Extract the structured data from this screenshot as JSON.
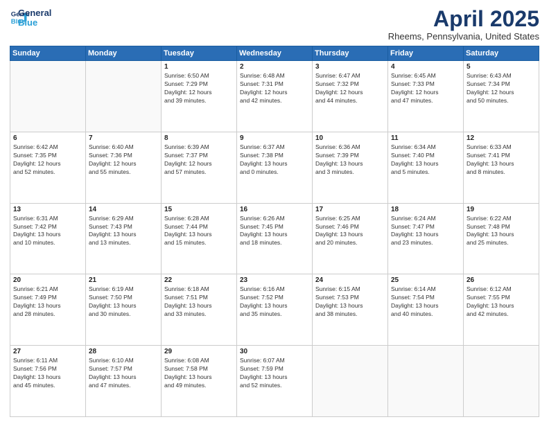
{
  "logo": {
    "line1": "General",
    "line2": "Blue"
  },
  "title": "April 2025",
  "location": "Rheems, Pennsylvania, United States",
  "days_of_week": [
    "Sunday",
    "Monday",
    "Tuesday",
    "Wednesday",
    "Thursday",
    "Friday",
    "Saturday"
  ],
  "weeks": [
    [
      {
        "day": "",
        "info": ""
      },
      {
        "day": "",
        "info": ""
      },
      {
        "day": "1",
        "info": "Sunrise: 6:50 AM\nSunset: 7:29 PM\nDaylight: 12 hours\nand 39 minutes."
      },
      {
        "day": "2",
        "info": "Sunrise: 6:48 AM\nSunset: 7:31 PM\nDaylight: 12 hours\nand 42 minutes."
      },
      {
        "day": "3",
        "info": "Sunrise: 6:47 AM\nSunset: 7:32 PM\nDaylight: 12 hours\nand 44 minutes."
      },
      {
        "day": "4",
        "info": "Sunrise: 6:45 AM\nSunset: 7:33 PM\nDaylight: 12 hours\nand 47 minutes."
      },
      {
        "day": "5",
        "info": "Sunrise: 6:43 AM\nSunset: 7:34 PM\nDaylight: 12 hours\nand 50 minutes."
      }
    ],
    [
      {
        "day": "6",
        "info": "Sunrise: 6:42 AM\nSunset: 7:35 PM\nDaylight: 12 hours\nand 52 minutes."
      },
      {
        "day": "7",
        "info": "Sunrise: 6:40 AM\nSunset: 7:36 PM\nDaylight: 12 hours\nand 55 minutes."
      },
      {
        "day": "8",
        "info": "Sunrise: 6:39 AM\nSunset: 7:37 PM\nDaylight: 12 hours\nand 57 minutes."
      },
      {
        "day": "9",
        "info": "Sunrise: 6:37 AM\nSunset: 7:38 PM\nDaylight: 13 hours\nand 0 minutes."
      },
      {
        "day": "10",
        "info": "Sunrise: 6:36 AM\nSunset: 7:39 PM\nDaylight: 13 hours\nand 3 minutes."
      },
      {
        "day": "11",
        "info": "Sunrise: 6:34 AM\nSunset: 7:40 PM\nDaylight: 13 hours\nand 5 minutes."
      },
      {
        "day": "12",
        "info": "Sunrise: 6:33 AM\nSunset: 7:41 PM\nDaylight: 13 hours\nand 8 minutes."
      }
    ],
    [
      {
        "day": "13",
        "info": "Sunrise: 6:31 AM\nSunset: 7:42 PM\nDaylight: 13 hours\nand 10 minutes."
      },
      {
        "day": "14",
        "info": "Sunrise: 6:29 AM\nSunset: 7:43 PM\nDaylight: 13 hours\nand 13 minutes."
      },
      {
        "day": "15",
        "info": "Sunrise: 6:28 AM\nSunset: 7:44 PM\nDaylight: 13 hours\nand 15 minutes."
      },
      {
        "day": "16",
        "info": "Sunrise: 6:26 AM\nSunset: 7:45 PM\nDaylight: 13 hours\nand 18 minutes."
      },
      {
        "day": "17",
        "info": "Sunrise: 6:25 AM\nSunset: 7:46 PM\nDaylight: 13 hours\nand 20 minutes."
      },
      {
        "day": "18",
        "info": "Sunrise: 6:24 AM\nSunset: 7:47 PM\nDaylight: 13 hours\nand 23 minutes."
      },
      {
        "day": "19",
        "info": "Sunrise: 6:22 AM\nSunset: 7:48 PM\nDaylight: 13 hours\nand 25 minutes."
      }
    ],
    [
      {
        "day": "20",
        "info": "Sunrise: 6:21 AM\nSunset: 7:49 PM\nDaylight: 13 hours\nand 28 minutes."
      },
      {
        "day": "21",
        "info": "Sunrise: 6:19 AM\nSunset: 7:50 PM\nDaylight: 13 hours\nand 30 minutes."
      },
      {
        "day": "22",
        "info": "Sunrise: 6:18 AM\nSunset: 7:51 PM\nDaylight: 13 hours\nand 33 minutes."
      },
      {
        "day": "23",
        "info": "Sunrise: 6:16 AM\nSunset: 7:52 PM\nDaylight: 13 hours\nand 35 minutes."
      },
      {
        "day": "24",
        "info": "Sunrise: 6:15 AM\nSunset: 7:53 PM\nDaylight: 13 hours\nand 38 minutes."
      },
      {
        "day": "25",
        "info": "Sunrise: 6:14 AM\nSunset: 7:54 PM\nDaylight: 13 hours\nand 40 minutes."
      },
      {
        "day": "26",
        "info": "Sunrise: 6:12 AM\nSunset: 7:55 PM\nDaylight: 13 hours\nand 42 minutes."
      }
    ],
    [
      {
        "day": "27",
        "info": "Sunrise: 6:11 AM\nSunset: 7:56 PM\nDaylight: 13 hours\nand 45 minutes."
      },
      {
        "day": "28",
        "info": "Sunrise: 6:10 AM\nSunset: 7:57 PM\nDaylight: 13 hours\nand 47 minutes."
      },
      {
        "day": "29",
        "info": "Sunrise: 6:08 AM\nSunset: 7:58 PM\nDaylight: 13 hours\nand 49 minutes."
      },
      {
        "day": "30",
        "info": "Sunrise: 6:07 AM\nSunset: 7:59 PM\nDaylight: 13 hours\nand 52 minutes."
      },
      {
        "day": "",
        "info": ""
      },
      {
        "day": "",
        "info": ""
      },
      {
        "day": "",
        "info": ""
      }
    ]
  ]
}
